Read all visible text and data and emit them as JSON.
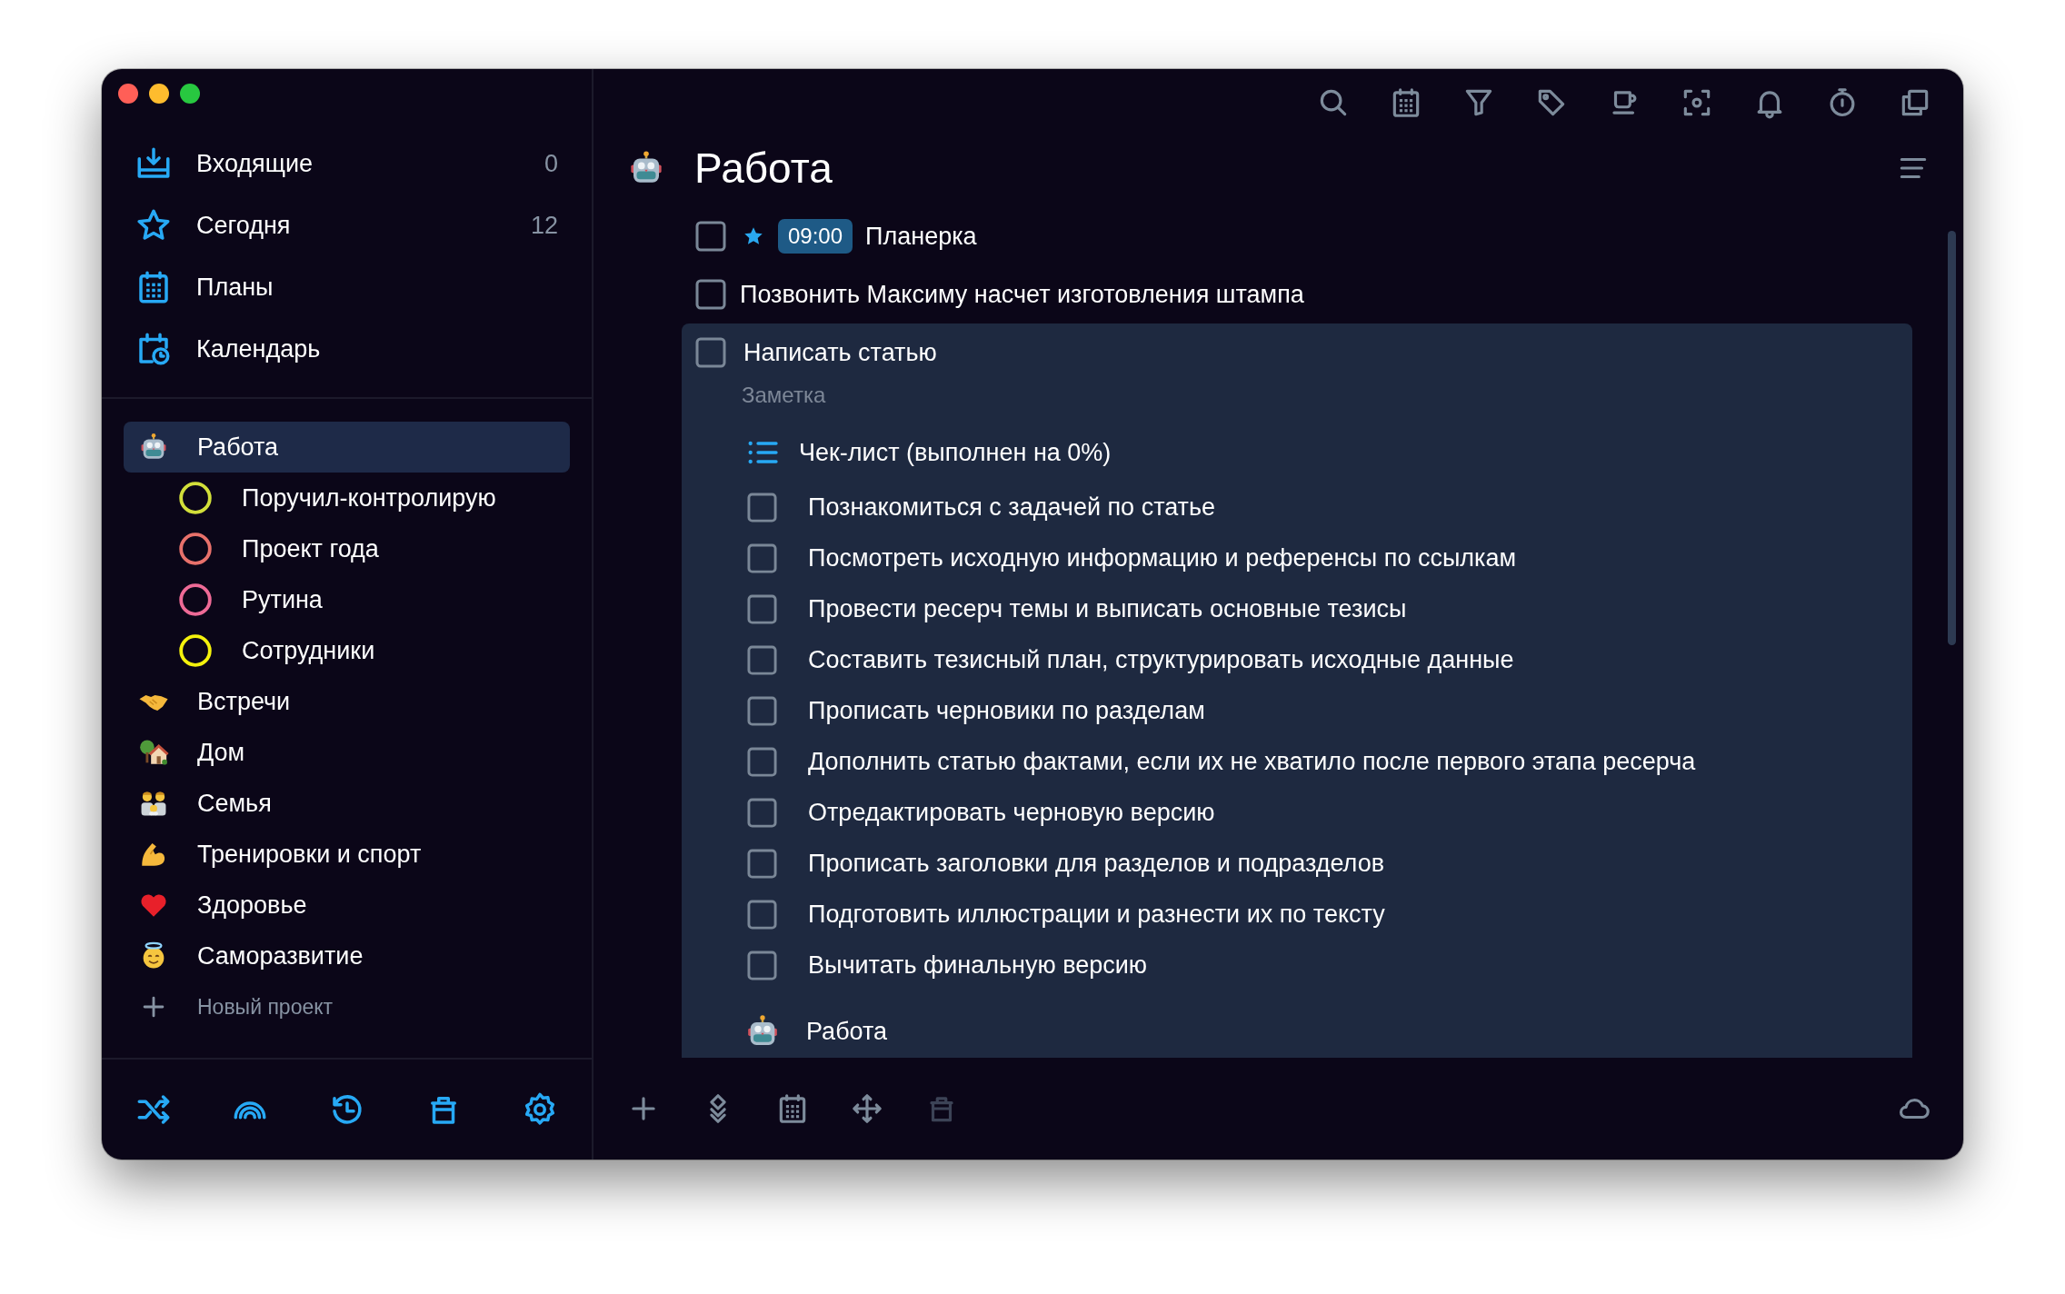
{
  "sidebar": {
    "views": [
      {
        "label": "Входящие",
        "count": "0"
      },
      {
        "label": "Сегодня",
        "count": "12"
      },
      {
        "label": "Планы"
      },
      {
        "label": "Календарь"
      }
    ],
    "projects": [
      {
        "name": "Работа",
        "selected": true,
        "children": [
          {
            "name": "Поручил-контролирую",
            "color": "#d2df3a"
          },
          {
            "name": "Проект года",
            "color": "#e8716b"
          },
          {
            "name": "Рутина",
            "color": "#ee6a96"
          },
          {
            "name": "Сотрудники",
            "color": "#f4f10c"
          }
        ]
      },
      {
        "name": "Встречи",
        "selected": false
      },
      {
        "name": "Дом",
        "selected": false
      },
      {
        "name": "Семья",
        "selected": false
      },
      {
        "name": "Тренировки и спорт",
        "selected": false
      },
      {
        "name": "Здоровье",
        "selected": false
      },
      {
        "name": "Саморазвитие",
        "selected": false
      }
    ],
    "new_project": "Новый проект"
  },
  "main": {
    "title": "Работа",
    "tasks": [
      {
        "title": "Планерка",
        "checked": false,
        "starred": true,
        "time": "09:00",
        "selected": false
      },
      {
        "title": "Позвонить Максиму насчет изготовления штампа",
        "checked": false,
        "starred": false,
        "selected": false
      },
      {
        "title": "Написать статью",
        "checked": false,
        "starred": false,
        "selected": true,
        "note_placeholder": "Заметка",
        "project": "Работа",
        "checklist": {
          "title": "Чек-лист (выполнен на 0%)",
          "items": [
            {
              "text": "Познакомиться с задачей по статье",
              "checked": false
            },
            {
              "text": "Посмотреть исходную информацию и референсы по ссылкам",
              "checked": false
            },
            {
              "text": "Провести ресерч темы и выписать основные тезисы",
              "checked": false
            },
            {
              "text": "Составить тезисный план, структурировать исходные данные",
              "checked": false
            },
            {
              "text": "Прописать черновики по разделам",
              "checked": false
            },
            {
              "text": "Дополнить статью фактами, если их не хватило после первого этапа ресерча",
              "checked": false
            },
            {
              "text": "Отредактировать черновую версию",
              "checked": false
            },
            {
              "text": "Прописать заголовки для разделов и подразделов",
              "checked": false
            },
            {
              "text": "Подготовить иллюстрации и разнести их по тексту",
              "checked": false
            },
            {
              "text": "Вычитать финальную версию",
              "checked": false
            }
          ]
        }
      }
    ],
    "bottom_toolbar": [
      {
        "disabled": false
      },
      {
        "disabled": false
      },
      {
        "disabled": false
      },
      {
        "disabled": false
      },
      {
        "disabled": true
      }
    ]
  }
}
